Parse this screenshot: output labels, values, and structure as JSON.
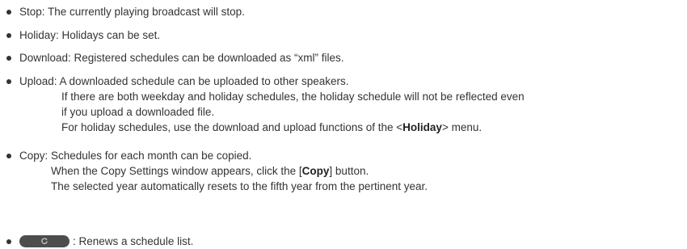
{
  "items": [
    {
      "lines": [
        "Stop: The currently playing broadcast will stop."
      ]
    },
    {
      "lines": [
        "Holiday: Holidays can be set."
      ]
    },
    {
      "lines": [
        "Download: Registered schedules can be downloaded as “xml” files."
      ]
    },
    {
      "first": "Upload:  A downloaded schedule can be uploaded to other speakers.",
      "l2": "If there are both weekday and holiday schedules, the holiday schedule will not be reflected even",
      "l3": "if you upload a downloaded file.",
      "l4_pre": "For holiday schedules, use the download and upload functions of the <",
      "l4_bold": "Holiday",
      "l4_post": "> menu."
    },
    {
      "first": "Copy: Schedules for each month can be copied.",
      "l2_pre": "When the Copy Settings window appears, click the [",
      "l2_bold": "Copy",
      "l2_post": "] button.",
      "l3": "The selected year automatically resets to the fifth year from the pertinent year."
    },
    {
      "text": ": Renews a schedule list.",
      "button_icon": "refresh-icon"
    }
  ]
}
